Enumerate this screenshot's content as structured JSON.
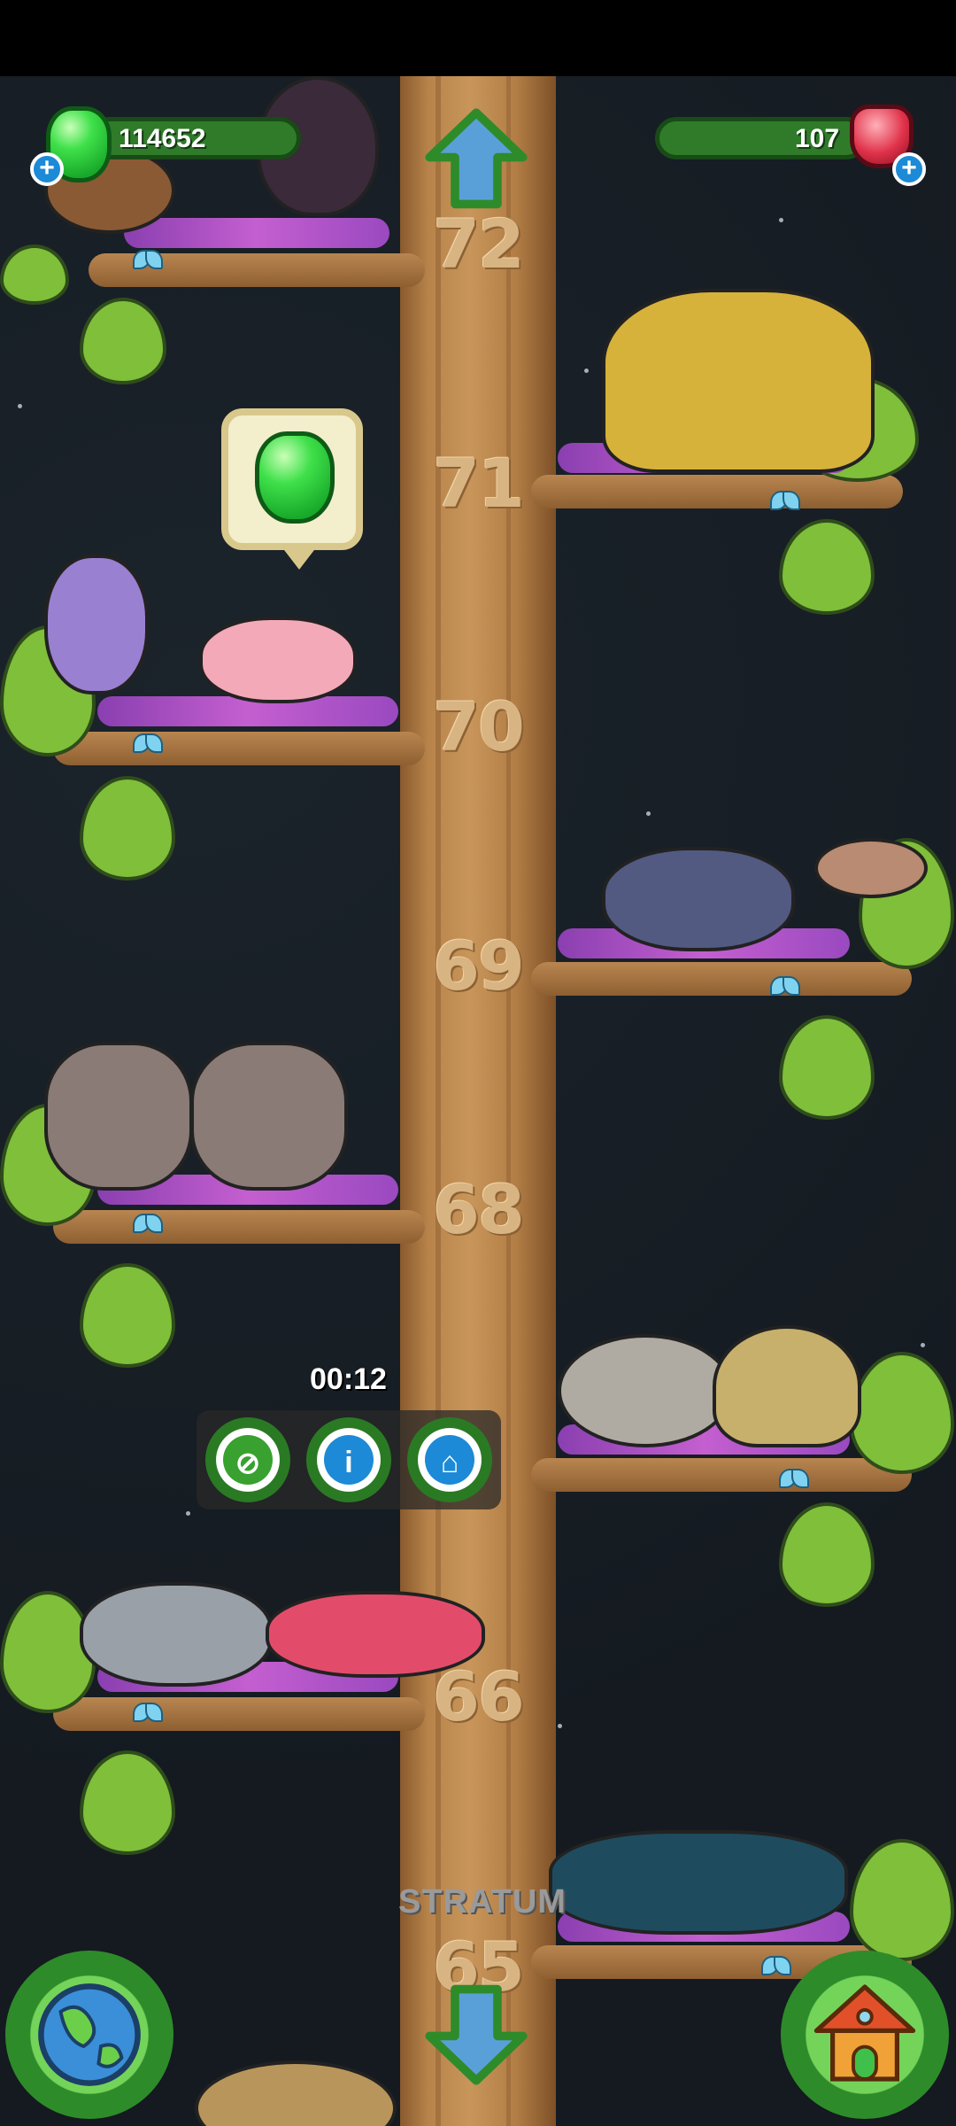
{
  "hud": {
    "green_currency": "114652",
    "red_currency": "107",
    "plus_label": "+"
  },
  "levels": [
    {
      "number": "72"
    },
    {
      "number": "71"
    },
    {
      "number": "70"
    },
    {
      "number": "69"
    },
    {
      "number": "68"
    },
    {
      "number": "66"
    },
    {
      "number": "65"
    }
  ],
  "popup": {
    "timer": "00:12",
    "actions": [
      {
        "icon": "net-icon"
      },
      {
        "icon": "info-icon"
      },
      {
        "icon": "barn-icon"
      }
    ]
  },
  "stratum_label": "STRATUM",
  "navigation": {
    "up": "arrow-up-icon",
    "down": "arrow-down-icon",
    "map": "globe-icon",
    "home": "house-icon"
  },
  "colors": {
    "green_gem": "#3fe04a",
    "red_gem": "#e0324a",
    "button_green": "#2e8b2a",
    "info_blue": "#1c8ad6"
  }
}
